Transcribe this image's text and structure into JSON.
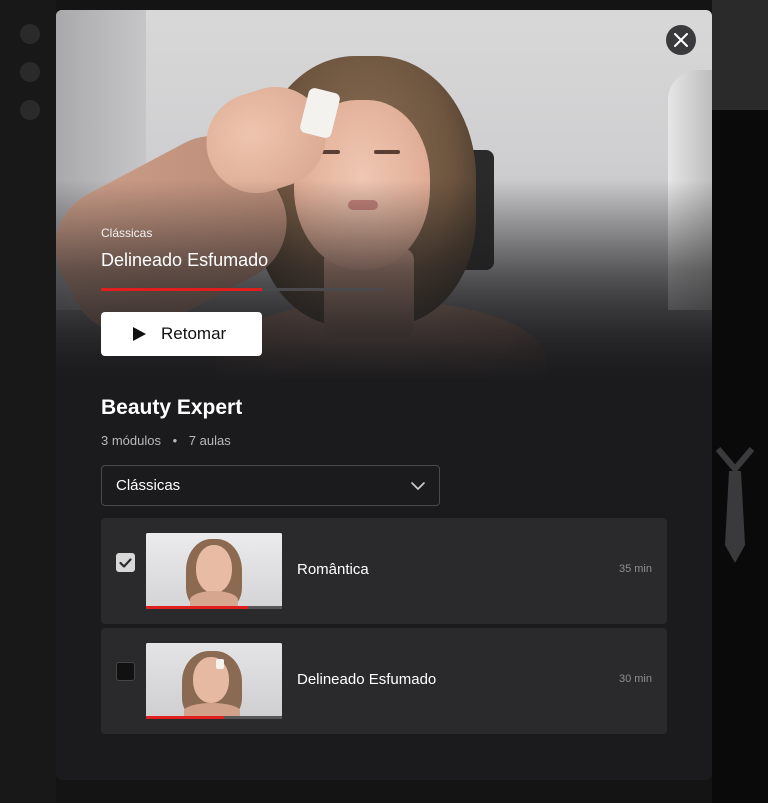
{
  "hero": {
    "category": "Clássicas",
    "title": "Delineado Esfumado",
    "progress": 0.57,
    "resume_label": "Retomar"
  },
  "course": {
    "title": "Beauty Expert",
    "modules": "3 módulos",
    "separator": "•",
    "lessons": "7 aulas"
  },
  "module_select": {
    "selected": "Clássicas"
  },
  "lessons": [
    {
      "title": "Romântica",
      "duration": "35 min",
      "completed": true,
      "progress": 0.75
    },
    {
      "title": "Delineado Esfumado",
      "duration": "30 min",
      "completed": false,
      "progress": 0.57
    }
  ],
  "colors": {
    "accent": "#e01e1e",
    "modal_bg": "#1b1b1d",
    "card_bg": "#2a2a2c"
  },
  "icons": {
    "close": "close-icon",
    "play": "play-icon",
    "chevron": "chevron-down-icon",
    "check": "check-icon"
  }
}
